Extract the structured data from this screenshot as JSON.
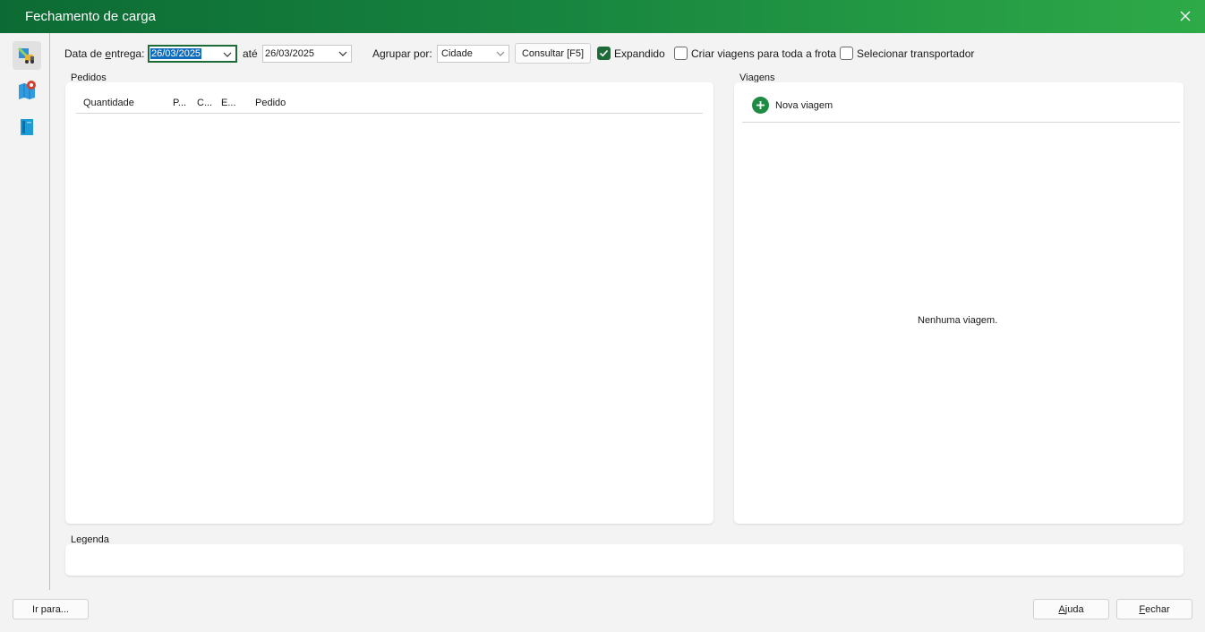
{
  "window": {
    "title": "Fechamento de carga"
  },
  "toolbar": {
    "date_label_pre": "Data de ",
    "date_label_u": "e",
    "date_label_post": "ntrega:",
    "date_from": "26/03/2025",
    "until_label": "até",
    "date_to": "26/03/2025",
    "group_label": "Agrupar por:",
    "group_value": "Cidade",
    "consult_button": "Consultar [F5]",
    "expanded_label": "Expandido",
    "expanded_checked": true,
    "fleet_label": "Criar viagens para toda a frota",
    "fleet_checked": false,
    "carrier_label": "Selecionar transportador",
    "carrier_checked": false
  },
  "orders": {
    "section_label": "Pedidos",
    "columns": [
      "Quantidade",
      "P...",
      "C...",
      "E...",
      "Pedido"
    ],
    "rows": []
  },
  "trips": {
    "section_label": "Viagens",
    "new_trip_label": "Nova viagem",
    "empty_text": "Nenhuma viagem."
  },
  "legend": {
    "section_label": "Legenda"
  },
  "footer": {
    "goto_button": "Ir para...",
    "help_u": "A",
    "help_rest": "juda",
    "close_u": "F",
    "close_rest": "echar"
  },
  "colors": {
    "accent": "#1e6b3a",
    "title_gradient_start": "#0c6b34",
    "title_gradient_end": "#2eaa48"
  },
  "sidebar": {
    "icons": [
      "truck-map-icon",
      "map-pin-icon",
      "book-icon"
    ]
  }
}
